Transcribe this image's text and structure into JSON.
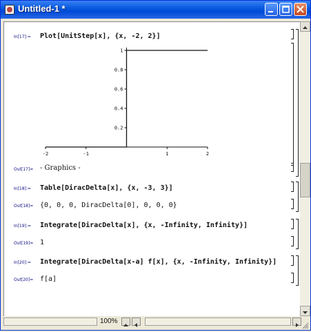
{
  "window": {
    "title": "Untitled-1 *"
  },
  "cells": [
    {
      "label": "In[17]:=",
      "code": "Plot[UnitStep[x], {x, -2, 2}]"
    },
    {
      "label": "Out[17]=",
      "code": "- Graphics -"
    },
    {
      "label": "In[18]:=",
      "code": "Table[DiracDelta[x], {x, -3, 3}]"
    },
    {
      "label": "Out[18]=",
      "code": "{0, 0, 0, DiracDelta[0], 0, 0, 0}"
    },
    {
      "label": "In[19]:=",
      "code": "Integrate[DiracDelta[x], {x, -Infinity, Infinity}]"
    },
    {
      "label": "Out[19]=",
      "code": "1"
    },
    {
      "label": "In[20]:=",
      "code": "Integrate[DiracDelta[x-a] f[x], {x, -Infinity, Infinity}]"
    },
    {
      "label": "Out[20]=",
      "code": "f[a]"
    }
  ],
  "plot": {
    "x_ticks": [
      "-2",
      "-1",
      "1",
      "2"
    ],
    "y_ticks": [
      "1",
      "0.8",
      "0.6",
      "0.4",
      "0.2"
    ]
  },
  "status": {
    "zoom": "100%"
  },
  "chart_data": {
    "type": "line",
    "x": [
      -2,
      0,
      0,
      2
    ],
    "y": [
      0,
      0,
      1,
      1
    ],
    "xlim": [
      -2,
      2
    ],
    "ylim": [
      0,
      1
    ]
  }
}
